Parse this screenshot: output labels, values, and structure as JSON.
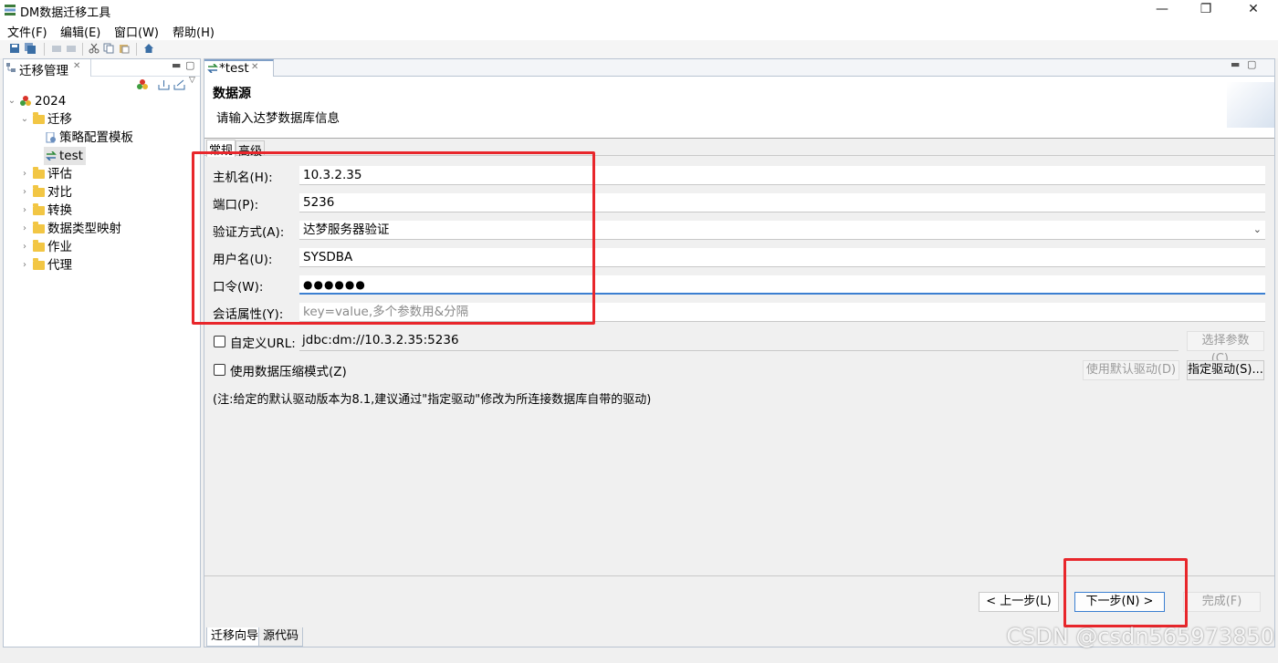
{
  "app": {
    "title": "DM数据迁移工具"
  },
  "window_controls": {
    "minimize": "—",
    "restore": "❐",
    "close": "✕"
  },
  "menu": [
    "文件(F)",
    "编辑(E)",
    "窗口(W)",
    "帮助(H)"
  ],
  "left_panel": {
    "tab_label": "迁移管理",
    "tree": {
      "root": "2024",
      "migration": "迁移",
      "migration_children": [
        "策略配置模板",
        "test"
      ],
      "folders": [
        "评估",
        "对比",
        "转换",
        "数据类型映射",
        "作业",
        "代理"
      ]
    }
  },
  "editor": {
    "tab_label": "*test",
    "header": {
      "title": "数据源",
      "subtitle": "请输入达梦数据库信息"
    },
    "subtabs": [
      "常规",
      "高级"
    ],
    "fields": [
      {
        "label": "主机名(H):",
        "value": "10.3.2.35"
      },
      {
        "label": "端口(P):",
        "value": "5236"
      },
      {
        "label": "验证方式(A):",
        "value": "达梦服务器验证"
      },
      {
        "label": "用户名(U):",
        "value": "SYSDBA"
      },
      {
        "label": "口令(W):",
        "value": "●●●●●●"
      },
      {
        "label": "会话属性(Y):",
        "placeholder": "key=value,多个参数用&分隔"
      }
    ],
    "custom_url": {
      "label": "自定义URL:",
      "value": "jdbc:dm://10.3.2.35:5236",
      "button": "选择参数(C)..."
    },
    "compress": {
      "label": "使用数据压缩模式(Z)",
      "default_driver_button": "使用默认驱动(D)",
      "specify_driver_button": "指定驱动(S)..."
    },
    "note": "(注:给定的默认驱动版本为8.1,建议通过\"指定驱动\"修改为所连接数据库自带的驱动)",
    "buttons": {
      "back": "< 上一步(L)",
      "next": "下一步(N) >",
      "finish": "完成(F)"
    },
    "bottom_tabs": [
      "迁移向导",
      "源代码"
    ]
  },
  "watermark": "CSDN @csdn565973850",
  "colors": {
    "highlight_box": "#e8262b",
    "accent": "#3b7fd1",
    "folder": "#f2c644"
  }
}
